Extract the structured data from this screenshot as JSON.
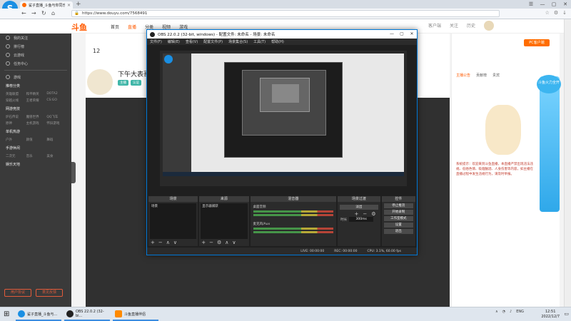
{
  "browser": {
    "tab_title": "鲨子直播_斗鱼与你同乐 ...",
    "url": "https://www.douyu.com/7568491",
    "new_tab": "+"
  },
  "site": {
    "logo": "斗鱼",
    "nav": [
      "首页",
      "直播",
      "分类",
      "视频",
      "游戏"
    ],
    "nav_right": [
      "客户端",
      "关注",
      "历史",
      "充值"
    ],
    "follow_count": "12",
    "room_title": "下午大表哥",
    "room_tags": [
      "主播",
      "认证"
    ],
    "chat_tabs": [
      "主播公告",
      "贡献榜",
      "贵宾"
    ],
    "chat_btn": "PC客户端",
    "chat_notice": "系统提示：欢迎来到斗鱼直播，本直播严禁出现违法违规、低俗色情、吸烟酗酒、人身伤害等内容，如主播在直播过程中发生违规行为，请及时举报。",
    "promo": "斗鱼火力全开",
    "sidebar": {
      "items": [
        "我的关注",
        "排行榜",
        "云游戏",
        "任务中心",
        "游戏"
      ],
      "heads": [
        "推荐分类",
        "网游竞技",
        "单机热游",
        "手游休闲",
        "娱乐天地"
      ],
      "grid": [
        "英雄联盟",
        "和平精英",
        "DOTA2",
        "穿越火线",
        "王者荣耀",
        "CS:GO",
        "炉石传说",
        "魔兽世界",
        "QQ飞车",
        "原神",
        "主机游戏",
        "怀旧游戏",
        "户外",
        "颜值",
        "舞蹈",
        "二次元",
        "音乐",
        "美食"
      ],
      "btn_left": "用户协议",
      "btn_right": "意见反馈"
    }
  },
  "obs": {
    "title": "OBS 22.0.2 (32-bit, windows) - 配置文件: 未命名 - 场景: 未命名",
    "menu": [
      "文件(F)",
      "编辑(E)",
      "查看(V)",
      "配置文件(P)",
      "场景集合(S)",
      "工具(T)",
      "帮助(H)"
    ],
    "docks": {
      "scenes": {
        "title": "场景",
        "items": [
          "场景"
        ]
      },
      "sources": {
        "title": "来源",
        "items": [
          "显示器捕获"
        ]
      },
      "mixer": {
        "title": "混音器",
        "rows": [
          "桌面音频",
          "麦克风/Aux"
        ]
      },
      "transitions": {
        "title": "场景过渡",
        "type": "淡出",
        "duration_label": "时长",
        "duration": "300ms"
      },
      "controls": {
        "title": "控件",
        "buttons": [
          "停止推流",
          "开始录制",
          "工作室模式",
          "设置",
          "退出"
        ]
      }
    },
    "status": [
      "LIVE: 00:00:00",
      "REC: 00:00:00",
      "CPU: 3.1%, 60.00 fps"
    ]
  },
  "taskbar": {
    "items": [
      "鲨子直播_斗鱼与...",
      "OBS 22.0.2 (32-bi...",
      "斗鱼直播伴侣"
    ],
    "tray_lang": "ENG",
    "time": "12:51",
    "date": "2022/12/7"
  }
}
